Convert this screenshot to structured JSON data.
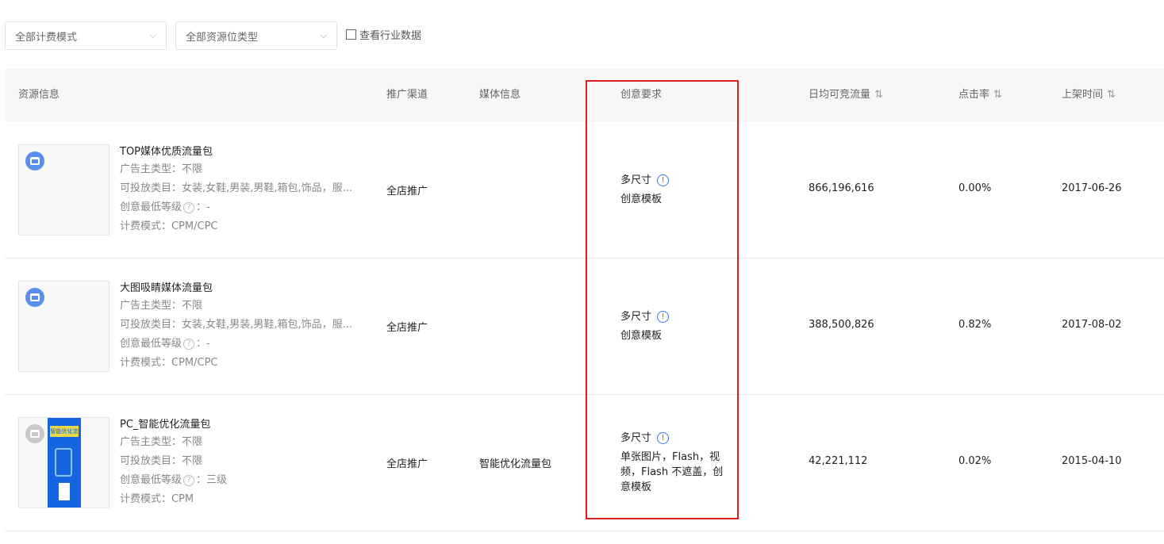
{
  "filters": {
    "billing_mode": "全部计费模式",
    "resource_type": "全部资源位类型",
    "industry_label": "查看行业数据"
  },
  "columns": {
    "resource_info": "资源信息",
    "channel": "推广渠道",
    "media_info": "媒体信息",
    "creative_req": "创意要求",
    "daily_traffic": "日均可竞流量",
    "ctr": "点击率",
    "listed_time": "上架时间"
  },
  "rows": [
    {
      "title": "TOP媒体优质流量包",
      "advertiser_type": "广告主类型：不限",
      "categories": "可投放类目：女装,女鞋,男装,男鞋,箱包,饰品，服...",
      "min_level_label": "创意最低等级",
      "min_level_value": "：-",
      "billing": "计费模式：CPM/CPC",
      "channel": "全店推广",
      "media": "",
      "size_label": "多尺寸",
      "creative_detail": "创意模板",
      "traffic": "866,196,616",
      "ctr": "0.00%",
      "date": "2017-06-26"
    },
    {
      "title": "大图吸睛媒体流量包",
      "advertiser_type": "广告主类型：不限",
      "categories": "可投放类目：女装,女鞋,男装,男鞋,箱包,饰品，服...",
      "min_level_label": "创意最低等级",
      "min_level_value": "：-",
      "billing": "计费模式：CPM/CPC",
      "channel": "全店推广",
      "media": "",
      "size_label": "多尺寸",
      "creative_detail": "创意模板",
      "traffic": "388,500,826",
      "ctr": "0.82%",
      "date": "2017-08-02"
    },
    {
      "title": "PC_智能优化流量包",
      "advertiser_type": "广告主类型：不限",
      "categories": "可投放类目：不限",
      "min_level_label": "创意最低等级",
      "min_level_value": "：三级",
      "billing": "计费模式：CPM",
      "channel": "全店推广",
      "media": "智能优化流量包",
      "size_label": "多尺寸",
      "creative_detail": "单张图片，Flash，视频，Flash 不遮盖，创意模板",
      "traffic": "42,221,112",
      "ctr": "0.02%",
      "date": "2015-04-10",
      "poster_text": "智能优化流量包"
    }
  ],
  "colors": {
    "highlight": "#e02020",
    "badge_active": "#5b8def",
    "badge_inactive": "#c9c9c9",
    "info_icon": "#3b7ae8"
  }
}
